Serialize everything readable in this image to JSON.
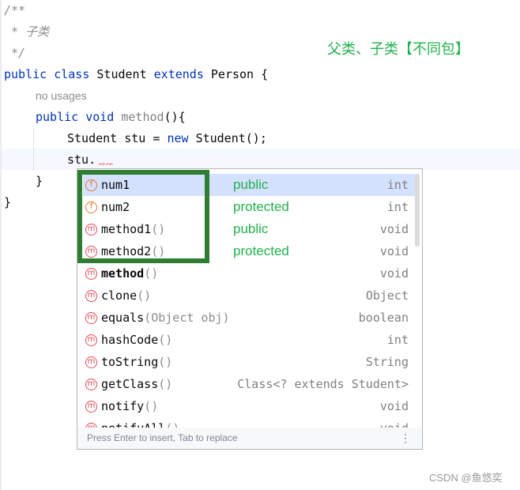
{
  "editor": {
    "lines": [
      {
        "text": "/**"
      },
      {
        "text": " * 子类"
      },
      {
        "text": " */"
      },
      {
        "kw1": "public class ",
        "cls": "Student ",
        "kw2": "extends ",
        "parent": "Person {"
      },
      {
        "hint": "no usages"
      },
      {
        "kw1": "public void ",
        "fn": "method",
        "rest": "(){"
      },
      {
        "a": "Student stu = ",
        "kw": "new ",
        "b": "Student();"
      },
      {
        "text": "stu."
      },
      {
        "text": "}"
      },
      {
        "text": "}"
      }
    ]
  },
  "annotation": "父类、子类【不同包】",
  "completion": {
    "items": [
      {
        "icon": "field-icon",
        "glyph": "f",
        "name": "num1",
        "params": "",
        "vis": "public",
        "type": "int"
      },
      {
        "icon": "field-icon",
        "glyph": "f",
        "name": "num2",
        "params": "",
        "vis": "protected",
        "type": "int"
      },
      {
        "icon": "method-icon",
        "glyph": "m",
        "name": "method1",
        "params": "()",
        "vis": "public",
        "type": "void"
      },
      {
        "icon": "method-icon",
        "glyph": "m",
        "name": "method2",
        "params": "()",
        "vis": "protected",
        "type": "void"
      },
      {
        "icon": "method-icon",
        "glyph": "m",
        "name": "method",
        "params": "()",
        "vis": "",
        "type": "void"
      },
      {
        "icon": "method-icon",
        "glyph": "m",
        "name": "clone",
        "params": "()",
        "vis": "",
        "type": "Object"
      },
      {
        "icon": "method-icon",
        "glyph": "m",
        "name": "equals",
        "params": "(Object obj)",
        "vis": "",
        "type": "boolean"
      },
      {
        "icon": "method-icon",
        "glyph": "m",
        "name": "hashCode",
        "params": "()",
        "vis": "",
        "type": "int"
      },
      {
        "icon": "method-icon",
        "glyph": "m",
        "name": "toString",
        "params": "()",
        "vis": "",
        "type": "String"
      },
      {
        "icon": "method-icon",
        "glyph": "m",
        "name": "getClass",
        "params": "()",
        "vis": "",
        "type": "Class<? extends Student>"
      },
      {
        "icon": "method-icon",
        "glyph": "m",
        "name": "notify",
        "params": "()",
        "vis": "",
        "type": "void"
      },
      {
        "icon": "method-icon",
        "glyph": "m",
        "name": "notifyAll",
        "params": "()",
        "vis": "",
        "type": "void"
      }
    ],
    "footer": "Press Enter to insert, Tab to replace",
    "menu_glyph": "⋮"
  },
  "watermark": "CSDN @鱼悠奕",
  "colors": {
    "highlight_box": "#2e7d32",
    "visibility_text": "#22b14c",
    "keyword": "#0033b3"
  }
}
